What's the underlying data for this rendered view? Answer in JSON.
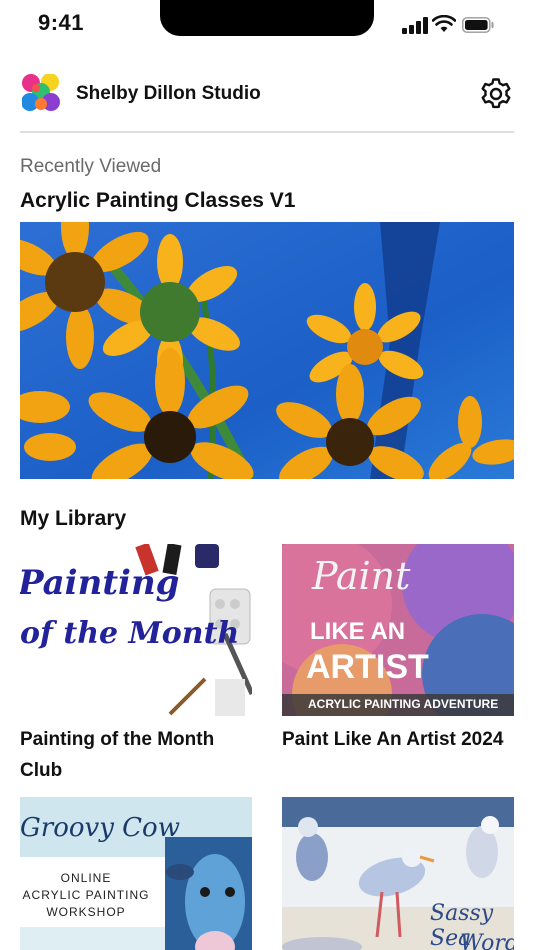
{
  "status_bar": {
    "time": "9:41"
  },
  "header": {
    "studio_name": "Shelby Dillon Studio"
  },
  "recent": {
    "label": "Recently Viewed",
    "title": "Acrylic Painting Classes V1"
  },
  "library": {
    "title": "My Library",
    "items": [
      {
        "caption": "Painting of the Month Club",
        "thumb_text": [
          "Painting",
          "of the Month"
        ]
      },
      {
        "caption": "Paint Like An Artist 2024",
        "thumb_text": [
          "Paint",
          "LIKE AN",
          "ARTIST",
          "ACRYLIC PAINTING ADVENTURE"
        ]
      },
      {
        "caption": "",
        "thumb_text": [
          "Groovy Cow",
          "ONLINE",
          "ACRYLIC PAINTING",
          "WORKSHOP"
        ]
      },
      {
        "caption": "",
        "thumb_text": [
          "Sassy Sea",
          "Words"
        ]
      }
    ]
  },
  "colors": {
    "accent_blue": "#1b5fc7",
    "sunflower": "#f2a311",
    "divider": "#dedede"
  }
}
